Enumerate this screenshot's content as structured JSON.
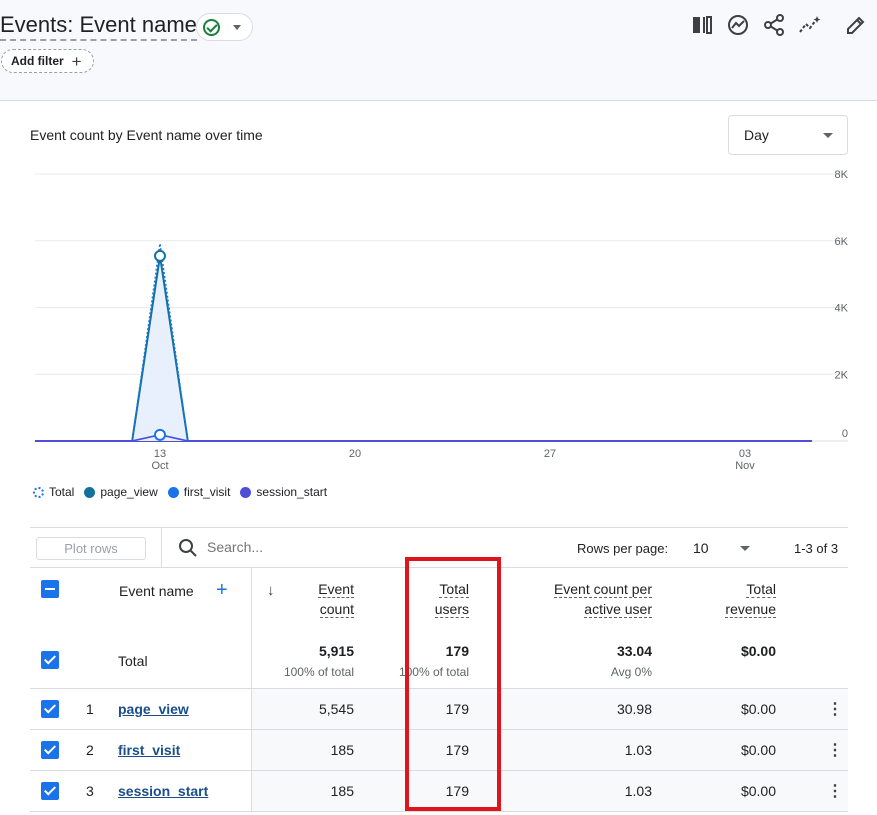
{
  "header": {
    "title": "Events: Event name",
    "add_filter_label": "Add filter",
    "toolbar_icons": [
      "compare-icon",
      "insights-icon",
      "share-icon",
      "trend-icon",
      "edit-icon"
    ]
  },
  "chart": {
    "title": "Event count by Event name over time",
    "granularity": "Day",
    "legend": [
      {
        "label": "Total",
        "color": "#1a73e8",
        "style": "dotted"
      },
      {
        "label": "page_view",
        "color": "#12729b"
      },
      {
        "label": "first_visit",
        "color": "#1a73e8"
      },
      {
        "label": "session_start",
        "color": "#4e4ed9"
      }
    ]
  },
  "chart_data": {
    "type": "area",
    "y_ticks": [
      "8K",
      "6K",
      "4K",
      "2K",
      "0"
    ],
    "ylim": [
      0,
      8000
    ],
    "x_ticks": [
      {
        "day": "13",
        "month": "Oct"
      },
      {
        "day": "20",
        "month": ""
      },
      {
        "day": "27",
        "month": ""
      },
      {
        "day": "03",
        "month": "Nov"
      }
    ],
    "x_range": [
      "2023-10-08",
      "2023-11-07"
    ],
    "grid": true,
    "series": [
      {
        "name": "Total",
        "points": [
          [
            "2023-10-12",
            0
          ],
          [
            "2023-10-13",
            5915
          ],
          [
            "2023-10-14",
            0
          ]
        ]
      },
      {
        "name": "page_view",
        "points": [
          [
            "2023-10-12",
            0
          ],
          [
            "2023-10-13",
            5545
          ],
          [
            "2023-10-14",
            0
          ]
        ]
      },
      {
        "name": "first_visit",
        "points": [
          [
            "2023-10-12",
            0
          ],
          [
            "2023-10-13",
            185
          ],
          [
            "2023-10-14",
            0
          ]
        ]
      },
      {
        "name": "session_start",
        "points": [
          [
            "2023-10-12",
            0
          ],
          [
            "2023-10-13",
            185
          ],
          [
            "2023-10-14",
            0
          ]
        ]
      }
    ]
  },
  "table_controls": {
    "plot_rows": "Plot rows",
    "search_placeholder": "Search...",
    "rows_per_page_label": "Rows per page:",
    "rows_per_page": "10",
    "pager": "1-3 of 3"
  },
  "table": {
    "columns": {
      "event_name": "Event name",
      "event_count": [
        "Event",
        "count"
      ],
      "total_users": [
        "Total",
        "users"
      ],
      "per_user": [
        "Event count per",
        "active user"
      ],
      "revenue": [
        "Total",
        "revenue"
      ]
    },
    "total": {
      "label": "Total",
      "event_count": "5,915",
      "event_count_sub": "100% of total",
      "total_users": "179",
      "total_users_sub": "100% of total",
      "per_user": "33.04",
      "per_user_sub": "Avg 0%",
      "revenue": "$0.00"
    },
    "rows": [
      {
        "index": "1",
        "name": "page_view",
        "event_count": "5,545",
        "total_users": "179",
        "per_user": "30.98",
        "revenue": "$0.00"
      },
      {
        "index": "2",
        "name": "first_visit",
        "event_count": "185",
        "total_users": "179",
        "per_user": "1.03",
        "revenue": "$0.00"
      },
      {
        "index": "3",
        "name": "session_start",
        "event_count": "185",
        "total_users": "179",
        "per_user": "1.03",
        "revenue": "$0.00"
      }
    ]
  },
  "annotation": {
    "highlight_color": "#e0141d"
  }
}
